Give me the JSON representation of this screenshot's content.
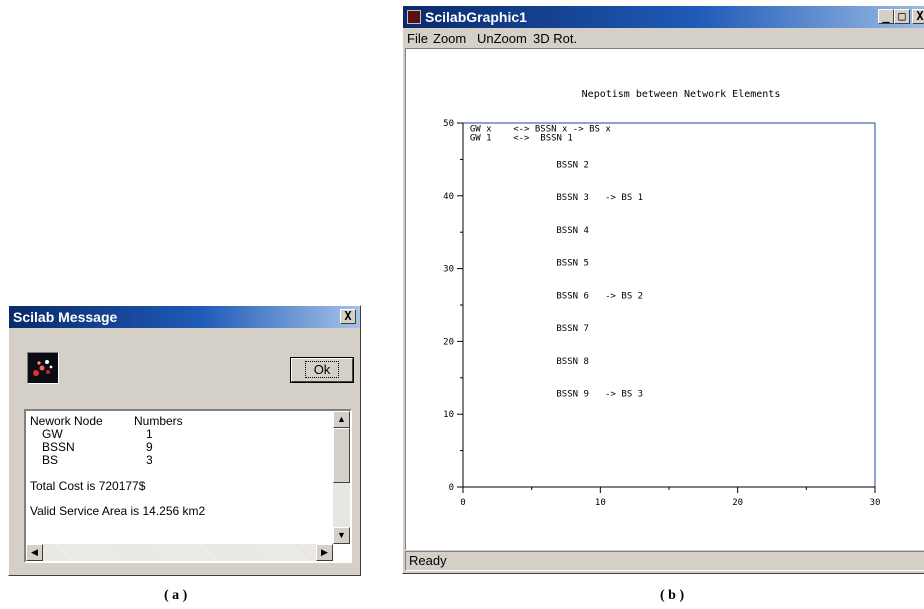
{
  "dialog": {
    "title": "Scilab Message",
    "close_glyph": "X",
    "ok_label": "Ok",
    "message": {
      "header_left": "Nework Node",
      "header_right": "Numbers",
      "rows": [
        {
          "node": "GW",
          "count": "1"
        },
        {
          "node": "BSSN",
          "count": "9"
        },
        {
          "node": "BS",
          "count": "3"
        }
      ],
      "total_cost": "Total Cost is 720177$",
      "service_area": "Valid Service Area is 14.256 km2"
    }
  },
  "graphic_window": {
    "title": "ScilabGraphic1",
    "menu": [
      "File",
      "Zoom",
      "UnZoom",
      "3D Rot."
    ],
    "status": "Ready",
    "plot": {
      "title": "Nepotism between Network Elements",
      "xlim": [
        0,
        30
      ],
      "ylim": [
        0,
        50
      ],
      "x_ticks": [
        "0",
        "10",
        "20",
        "30"
      ],
      "y_ticks": [
        "0",
        "10",
        "20",
        "30",
        "40",
        "50"
      ],
      "text_rows": [
        {
          "x": 0.5,
          "y": 48.8,
          "text": "GW x    <-> BSSN x -> BS x"
        },
        {
          "x": 0.5,
          "y": 47.6,
          "text": "GW 1    <->  BSSN 1"
        },
        {
          "x": 6.8,
          "y": 43.9,
          "text": "BSSN 2"
        },
        {
          "x": 6.8,
          "y": 39.4,
          "text": "BSSN 3   -> BS 1"
        },
        {
          "x": 6.8,
          "y": 34.9,
          "text": "BSSN 4"
        },
        {
          "x": 6.8,
          "y": 30.4,
          "text": "BSSN 5"
        },
        {
          "x": 6.8,
          "y": 25.9,
          "text": "BSSN 6   -> BS 2"
        },
        {
          "x": 6.8,
          "y": 21.4,
          "text": "BSSN 7"
        },
        {
          "x": 6.8,
          "y": 16.9,
          "text": "BSSN 8"
        },
        {
          "x": 6.8,
          "y": 12.4,
          "text": "BSSN 9   -> BS 3"
        }
      ]
    }
  },
  "captions": {
    "a": "( a )",
    "b": "( b )"
  }
}
